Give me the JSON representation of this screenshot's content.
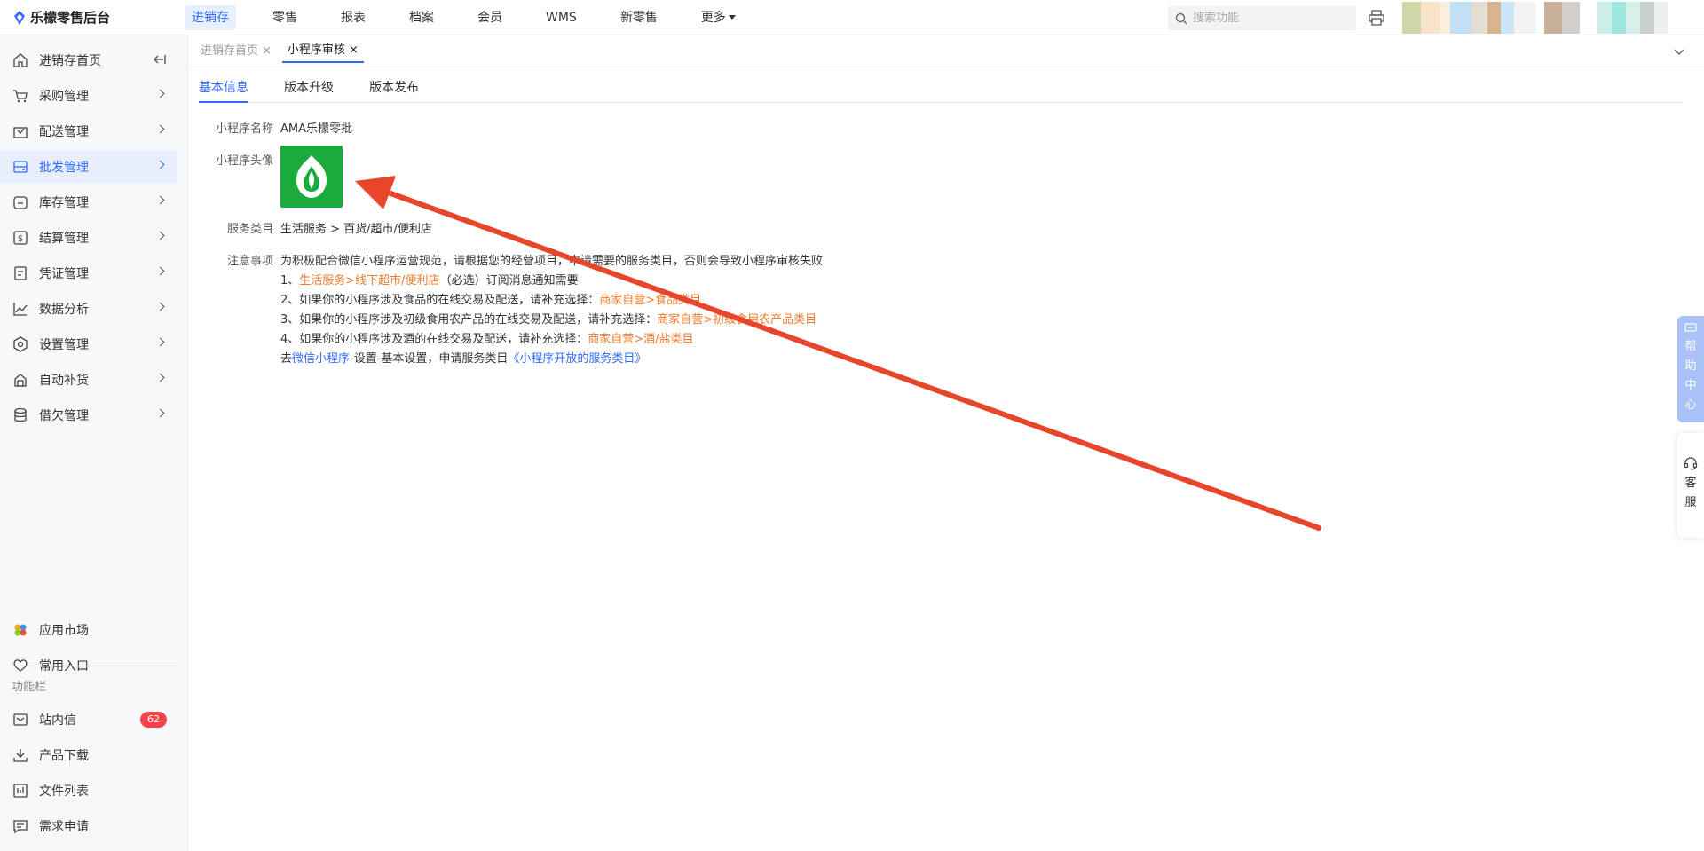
{
  "app": {
    "title": "乐檬零售后台"
  },
  "topnav": [
    {
      "label": "进销存",
      "active": true
    },
    {
      "label": "零售"
    },
    {
      "label": "报表"
    },
    {
      "label": "档案"
    },
    {
      "label": "会员"
    },
    {
      "label": "WMS"
    },
    {
      "label": "新零售"
    },
    {
      "label": "更多"
    }
  ],
  "search": {
    "placeholder": "搜索功能",
    "value": ""
  },
  "sidebar": {
    "items": [
      {
        "label": "进销存首页",
        "icon": "home-icon"
      },
      {
        "label": "采购管理",
        "icon": "cart-icon"
      },
      {
        "label": "配送管理",
        "icon": "delivery-icon"
      },
      {
        "label": "批发管理",
        "icon": "wholesale-icon",
        "active": true
      },
      {
        "label": "库存管理",
        "icon": "inventory-icon"
      },
      {
        "label": "结算管理",
        "icon": "settlement-icon"
      },
      {
        "label": "凭证管理",
        "icon": "voucher-icon"
      },
      {
        "label": "数据分析",
        "icon": "chart-icon"
      },
      {
        "label": "设置管理",
        "icon": "settings-icon"
      },
      {
        "label": "自动补货",
        "icon": "restock-icon"
      },
      {
        "label": "借欠管理",
        "icon": "debt-icon"
      }
    ],
    "bottom": [
      {
        "label": "应用市场",
        "icon": "app-market-icon"
      },
      {
        "label": "常用入口",
        "icon": "heart-icon"
      }
    ],
    "group_label": "功能栏",
    "tools": [
      {
        "label": "站内信",
        "icon": "mail-icon",
        "badge": "62"
      },
      {
        "label": "产品下载",
        "icon": "download-icon"
      },
      {
        "label": "文件列表",
        "icon": "file-list-icon"
      },
      {
        "label": "需求申请",
        "icon": "request-icon"
      }
    ]
  },
  "page_tabs": [
    {
      "label": "进销存首页",
      "close": "×"
    },
    {
      "label": "小程序审核",
      "close": "×",
      "active": true
    }
  ],
  "sub_tabs": [
    {
      "label": "基本信息",
      "active": true
    },
    {
      "label": "版本升级"
    },
    {
      "label": "版本发布"
    }
  ],
  "info": {
    "name_label": "小程序名称",
    "name_value": "AMA乐檬零批",
    "avatar_label": "小程序头像",
    "category_label": "服务类目",
    "category_value": "生活服务 > 百货/超市/便利店",
    "notes_label": "注意事项",
    "notes_intro": "为积极配合微信小程序运营规范，请根据您的经营项目，申请需要的服务类目，否则会导致小程序审核失败",
    "note1_prefix": "1、",
    "note1_link": "生活服务>线下超市/便利店",
    "note1_suffix": "（必选）订阅消息通知需要",
    "note2_prefix": "2、如果你的小程序涉及食品的在线交易及配送，请补充选择：",
    "note2_link": "商家自营>食品类目",
    "note3_prefix": "3、如果你的小程序涉及初级食用农产品的在线交易及配送，请补充选择：",
    "note3_link": "商家自营>初级食用农产品类目",
    "note4_prefix": "4、如果你的小程序涉及酒的在线交易及配送，请补充选择：",
    "note4_link": "商家自营>酒/盐类目",
    "go_prefix": "去",
    "go_link": "微信小程序",
    "go_middle": "-设置-基本设置，申请服务类目",
    "go_link2": "《小程序开放的服务类目》"
  },
  "float": {
    "help": [
      "帮",
      "助",
      "中",
      "心"
    ],
    "cs": [
      "客",
      "服"
    ]
  },
  "colors": {
    "accent": "#2f6bff",
    "link_orange": "#f27c2c",
    "avatar_green": "#1aab3c",
    "annotation_red": "#e8462b"
  }
}
